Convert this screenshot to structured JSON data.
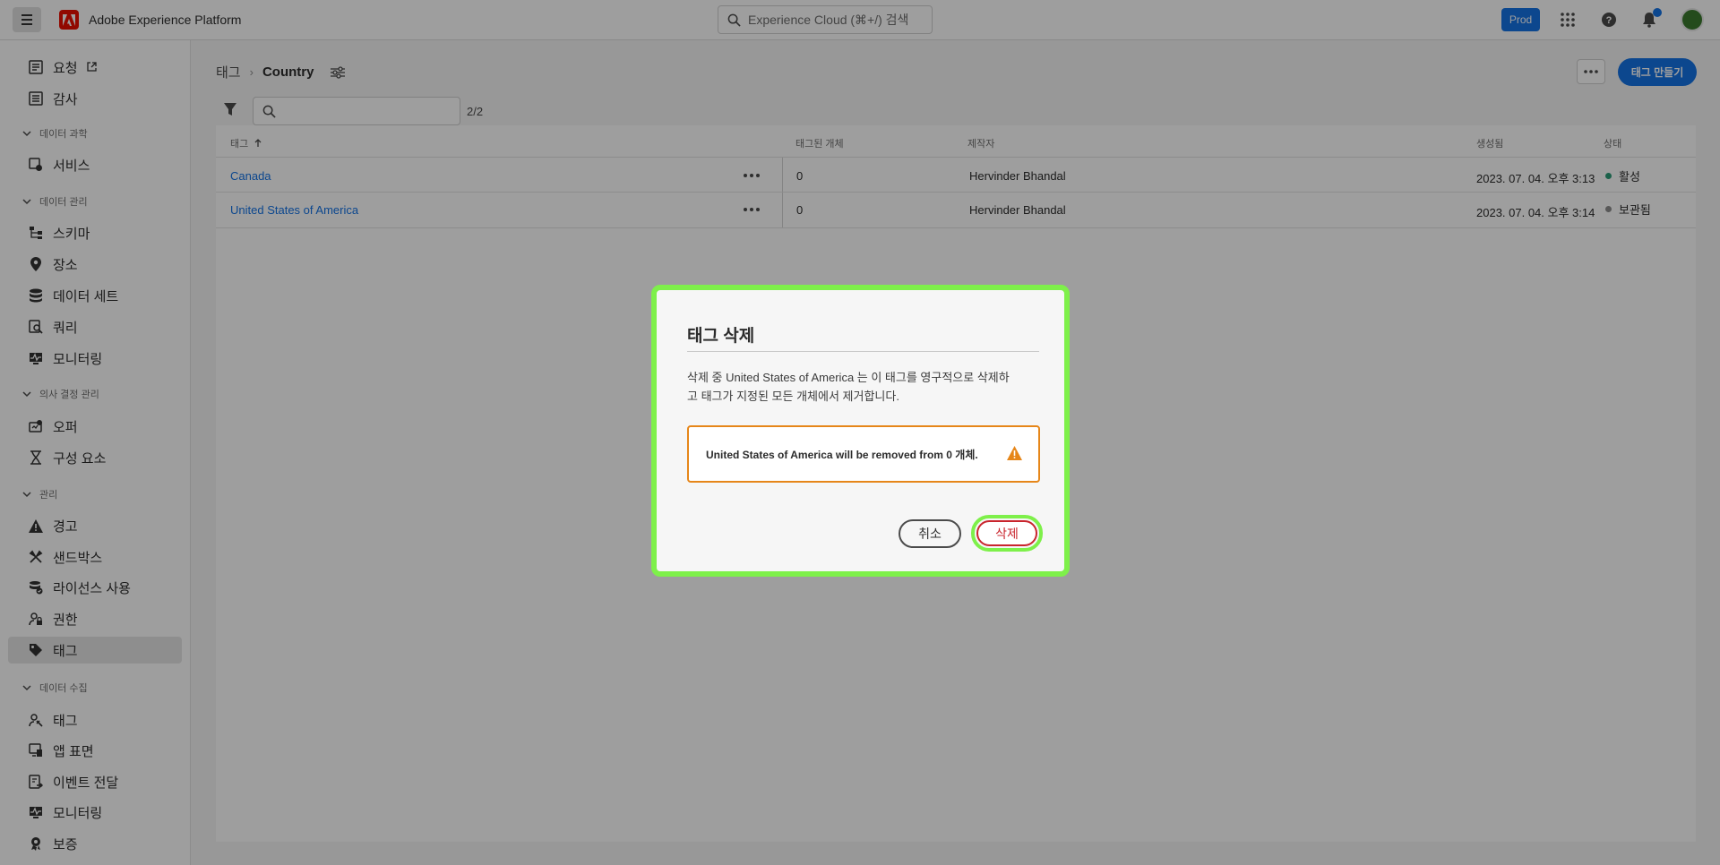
{
  "header": {
    "app_title": "Adobe Experience Platform",
    "search_placeholder": "Experience Cloud (⌘+/) 검색",
    "env_badge": "Prod",
    "icons": [
      "menu-icon",
      "adobe-logo",
      "search-icon",
      "apps-icon",
      "help-icon",
      "bell-icon",
      "avatar"
    ]
  },
  "sidebar": {
    "items": [
      {
        "label": "요청",
        "icon": "request-icon",
        "external": true
      },
      {
        "label": "감사",
        "icon": "audit-icon"
      },
      {
        "section": "데이터 과학"
      },
      {
        "label": "서비스",
        "icon": "service-icon"
      },
      {
        "section": "데이터 관리"
      },
      {
        "label": "스키마",
        "icon": "schema-icon"
      },
      {
        "label": "장소",
        "icon": "location-icon"
      },
      {
        "label": "데이터 세트",
        "icon": "dataset-icon"
      },
      {
        "label": "쿼리",
        "icon": "query-icon"
      },
      {
        "label": "모니터링",
        "icon": "monitoring-icon"
      },
      {
        "section": "의사 결정 관리"
      },
      {
        "label": "오퍼",
        "icon": "offer-icon"
      },
      {
        "label": "구성 요소",
        "icon": "components-icon"
      },
      {
        "section": "관리"
      },
      {
        "label": "경고",
        "icon": "alert-icon"
      },
      {
        "label": "샌드박스",
        "icon": "sandbox-icon"
      },
      {
        "label": "라이선스 사용",
        "icon": "license-icon"
      },
      {
        "label": "권한",
        "icon": "permissions-icon"
      },
      {
        "label": "태그",
        "icon": "tag-icon",
        "selected": true
      },
      {
        "section": "데이터 수집"
      },
      {
        "label": "태그",
        "icon": "tags-icon"
      },
      {
        "label": "앱 표면",
        "icon": "app-surface-icon"
      },
      {
        "label": "이벤트 전달",
        "icon": "event-forwarding-icon"
      },
      {
        "label": "모니터링",
        "icon": "monitoring-icon"
      },
      {
        "label": "보증",
        "icon": "assurance-icon"
      }
    ]
  },
  "page": {
    "breadcrumb_parent": "태그",
    "breadcrumb_current": "Country",
    "create_button": "태그 만들기",
    "result_count": "2/2",
    "columns": [
      "태그",
      "태그된 개체",
      "제작자",
      "생성됨",
      "상태"
    ],
    "rows": [
      {
        "name": "Canada",
        "tagged": "0",
        "creator": "Hervinder Bhandal",
        "created": "2023. 07. 04. 오후 3:13",
        "status": "활성",
        "status_color": "#2d9d78"
      },
      {
        "name": "United States of America",
        "tagged": "0",
        "creator": "Hervinder Bhandal",
        "created": "2023. 07. 04. 오후 3:14",
        "status": "보관됨",
        "status_color": "#8e8e8e"
      }
    ]
  },
  "dialog": {
    "title": "태그 삭제",
    "body_line1": "삭제 중 United States of America 는 이 태그를 영구적으로 삭제하",
    "body_line2": "고 태그가 지정된 모든 개체에서 제거합니다.",
    "warning": "United States of America will be removed from 0 개체.",
    "cancel": "취소",
    "delete": "삭제"
  },
  "colors": {
    "accent": "#1473e6",
    "highlight": "#7ef04a",
    "warning": "#e68619",
    "negative": "#c9252d"
  }
}
